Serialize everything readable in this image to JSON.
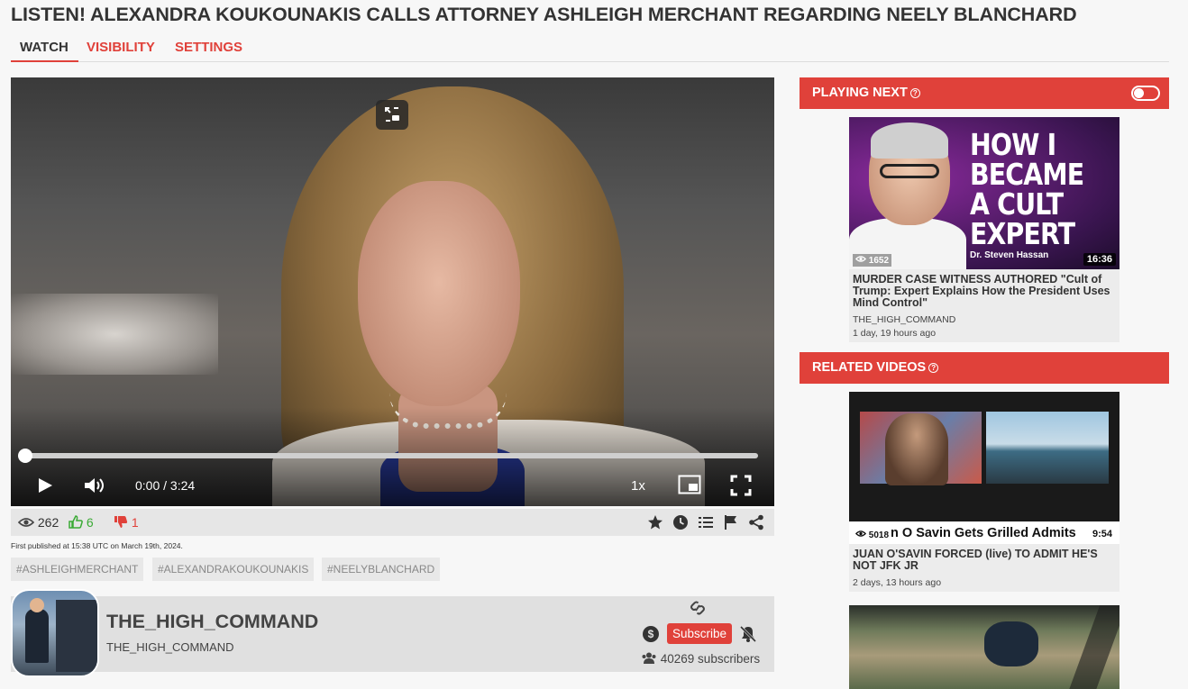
{
  "page": {
    "title": "LISTEN! ALEXANDRA KOUKOUNAKIS CALLS ATTORNEY ASHLEIGH MERCHANT REGARDING NEELY BLANCHARD"
  },
  "tabs": [
    {
      "label": "WATCH",
      "active": true
    },
    {
      "label": "VISIBILITY",
      "active": false
    },
    {
      "label": "SETTINGS",
      "active": false
    }
  ],
  "player": {
    "current_time": "0:00",
    "separator": "/",
    "duration": "3:24",
    "speed": "1x",
    "progress_fraction": 0.0
  },
  "stats": {
    "views": "262",
    "likes": "6",
    "dislikes": "1"
  },
  "published": "First published at 15:38 UTC on March 19th, 2024.",
  "tags": [
    "#ASHLEIGHMERCHANT",
    "#ALEXANDRAKOUKOUNAKIS",
    "#NEELYBLANCHARD"
  ],
  "channel": {
    "name": "THE_HIGH_COMMAND",
    "handle": "THE_HIGH_COMMAND",
    "subscribe_label": "Subscribe",
    "subscribers": "40269 subscribers"
  },
  "sidebar": {
    "playing_next_label": "PLAYING NEXT",
    "related_label": "RELATED VIDEOS",
    "autoplay_on": false
  },
  "playing_next": {
    "thumb_text": [
      "HOW I",
      "BECAME",
      "A CULT",
      "EXPERT"
    ],
    "thumb_caption": "Dr. Steven Hassan",
    "views": "1652",
    "duration": "16:36",
    "title": "MURDER CASE WITNESS AUTHORED \"Cult of Trump: Expert Explains How the President Uses Mind Control\"",
    "channel": "THE_HIGH_COMMAND",
    "age": "1 day, 19 hours ago"
  },
  "related": [
    {
      "thumb_text": "n O Savin Gets Grilled Admits",
      "views": "5018",
      "duration": "9:54",
      "title": "JUAN O'SAVIN FORCED (live) TO ADMIT HE'S NOT JFK JR",
      "age": "2 days, 13 hours ago"
    }
  ],
  "colors": {
    "accent": "#e0413a",
    "like": "#3aaa35",
    "dislike": "#e0413a"
  },
  "icons": {
    "views": "eye-icon",
    "like": "thumbs-up-icon",
    "dislike": "thumbs-down-icon",
    "favorite": "star-icon",
    "watch_later": "clock-icon",
    "playlist": "list-icon",
    "report": "flag-icon",
    "share": "share-icon"
  }
}
